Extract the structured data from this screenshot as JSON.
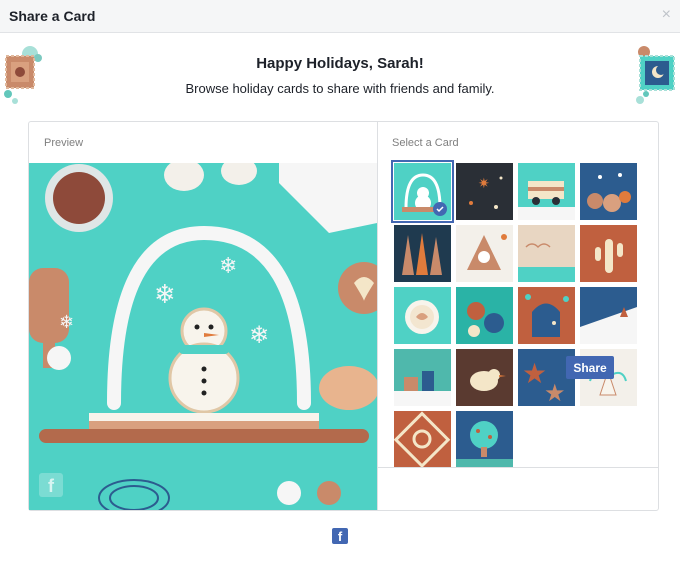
{
  "window": {
    "title": "Share a Card",
    "close_glyph": "×"
  },
  "header": {
    "title": "Happy Holidays, Sarah!",
    "subtitle": "Browse holiday cards to share with friends and family."
  },
  "preview": {
    "label": "Preview",
    "card": "snowman-snow-globe"
  },
  "select": {
    "label": "Select a Card",
    "cards": [
      {
        "name": "card-snow-globe",
        "selected": true
      },
      {
        "name": "card-starry-night"
      },
      {
        "name": "card-camper-van"
      },
      {
        "name": "card-blue-sweets"
      },
      {
        "name": "card-forest-pattern"
      },
      {
        "name": "card-gingerbread"
      },
      {
        "name": "card-beige-landscape"
      },
      {
        "name": "card-cactus"
      },
      {
        "name": "card-latte"
      },
      {
        "name": "card-ornaments"
      },
      {
        "name": "card-arch-door"
      },
      {
        "name": "card-snowy-hill"
      },
      {
        "name": "card-village"
      },
      {
        "name": "card-bird"
      },
      {
        "name": "card-star-cookies"
      },
      {
        "name": "card-angel"
      },
      {
        "name": "card-knot-pattern"
      },
      {
        "name": "card-blue-tree"
      }
    ]
  },
  "actions": {
    "share_label": "Share"
  },
  "footer": {
    "facebook_glyph": "f"
  },
  "colors": {
    "accent": "#4267b2",
    "teal": "#4fd1c5"
  }
}
